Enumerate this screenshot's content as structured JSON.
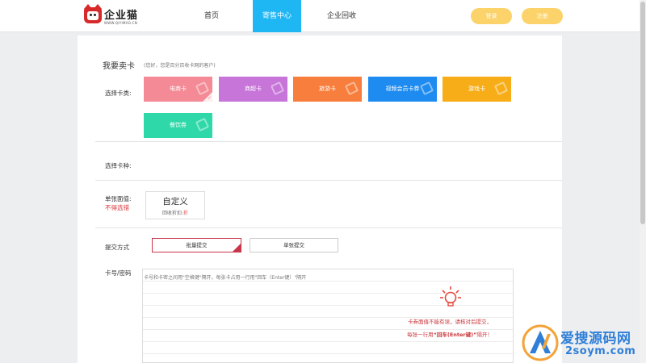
{
  "header": {
    "logo_text": "企业猫",
    "logo_url": "WWW.QIYIMAO.CN",
    "nav": [
      {
        "label": "首页",
        "active": false
      },
      {
        "label": "寄售中心",
        "active": true
      },
      {
        "label": "企业回收",
        "active": false
      }
    ],
    "login_label": "登录",
    "register_label": "注册",
    "accent_color": "#1fb6f4",
    "button_color": "#fcd36a"
  },
  "form": {
    "title": "我要卖卡",
    "subtitle": "(您好，您是百分百收卡网的客户)",
    "card_type_label": "选择卡类:",
    "card_types": [
      {
        "label": "电商卡",
        "color": "#f48a95",
        "selected": true
      },
      {
        "label": "商超卡",
        "color": "#c775d9",
        "selected": false
      },
      {
        "label": "旅游卡",
        "color": "#f77e3c",
        "selected": false
      },
      {
        "label": "视频会员卡券",
        "color": "#1e8bf0",
        "selected": false
      },
      {
        "label": "游戏卡",
        "color": "#f7ad17",
        "selected": false
      },
      {
        "label": "餐饮券",
        "color": "#2ed8a8",
        "selected": false
      }
    ],
    "card_kind_label": "选择卡种:",
    "face_value_label": "单张面值:",
    "face_value_warning": "不得选错",
    "custom_value": {
      "title": "自定义",
      "discount_prefix": "回收折扣:",
      "discount_unit": "折"
    },
    "submit_mode_label": "提交方式",
    "submit_batch_label": "批量提交",
    "submit_single_label": "单张提交",
    "card_input_label": "卡号/密码",
    "card_input_placeholder": "卡号和卡密之间用\"空格键\"隔开，每张卡占用一行用\"回车（Enter键）\"隔开",
    "tip_line1": "卡券面值不能有误，请核对后提交，",
    "tip_line2_prefix": "每张一行用",
    "tip_line2_key": "“回车(Enter键)”",
    "tip_line2_suffix": "隔开！"
  },
  "watermark": {
    "line1": "爱搜源码网",
    "line2": "2soym.com"
  }
}
